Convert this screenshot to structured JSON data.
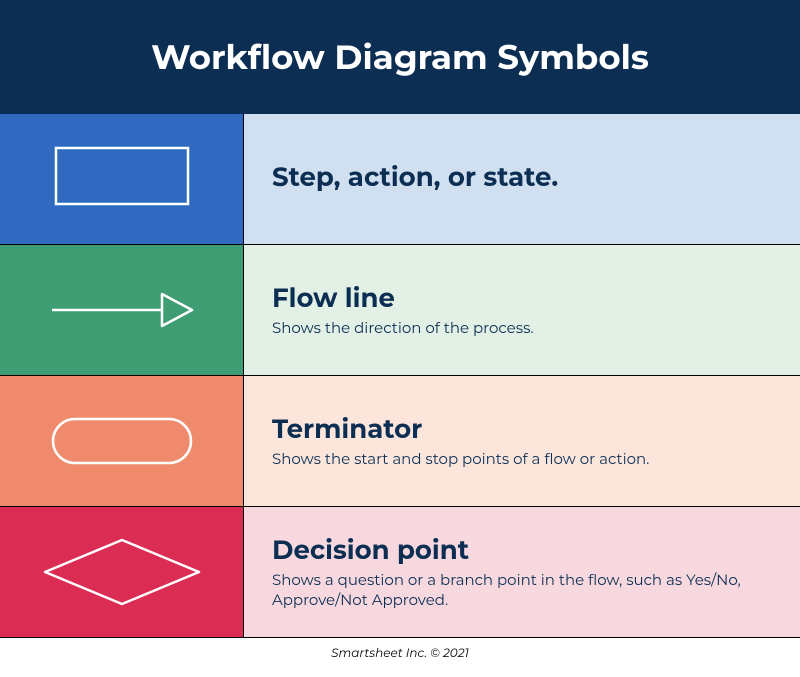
{
  "header": {
    "title": "Workflow Diagram Symbols"
  },
  "rows": [
    {
      "title": "Step, action, or state.",
      "desc": ""
    },
    {
      "title": "Flow line",
      "desc": "Shows the direction of the process."
    },
    {
      "title": "Terminator",
      "desc": "Shows the start and stop points of a flow or action."
    },
    {
      "title": "Decision point",
      "desc": "Shows a question or a branch point in the flow, such as Yes/No, Approve/Not Approved."
    }
  ],
  "footer": {
    "text": "Smartsheet Inc. © 2021"
  }
}
